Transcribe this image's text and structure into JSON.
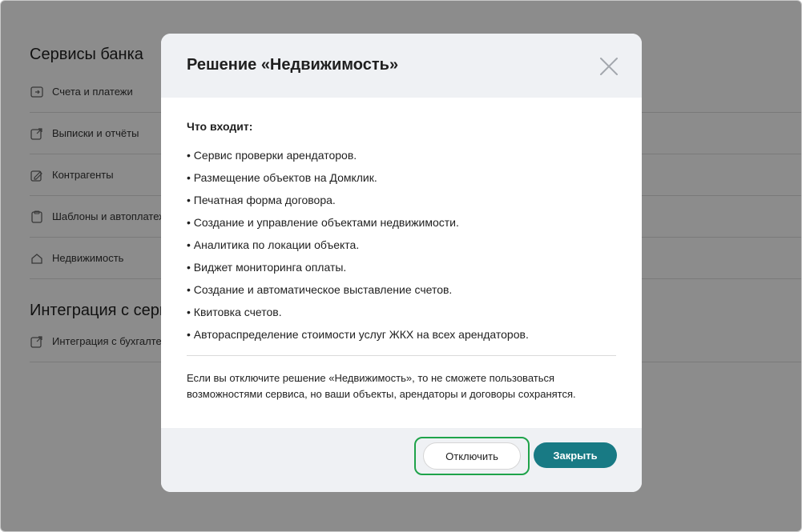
{
  "background": {
    "sections": [
      {
        "title": "Сервисы банка",
        "items": [
          {
            "label": "Счета и платежи"
          },
          {
            "label": "Выписки и отчёты"
          },
          {
            "label": "Контрагенты"
          },
          {
            "label": "Шаблоны и автоплатежи"
          },
          {
            "label": "Недвижимость"
          }
        ]
      },
      {
        "title": "Интеграция с сервисами",
        "items": [
          {
            "label": "Интеграция с бухгалтерией"
          }
        ]
      }
    ]
  },
  "modal": {
    "title": "Решение «Недвижимость»",
    "section_heading": "Что входит:",
    "features": [
      "• Сервис проверки арендаторов.",
      "• Размещение объектов на Домклик.",
      "• Печатная форма договора.",
      "• Создание и управление объектами недвижимости.",
      "• Аналитика по локации объекта.",
      "• Виджет мониторинга оплаты.",
      "• Создание и автоматическое выставление счетов.",
      "• Квитовка счетов.",
      "• Автораспределение стоимости услуг ЖКХ на всех арендаторов."
    ],
    "note": "Если вы отключите решение «Недвижимость», то не сможете пользоваться возможностями сервиса, но ваши объекты, арендаторы и договоры сохранятся.",
    "buttons": {
      "disable": "Отключить",
      "close": "Закрыть"
    }
  },
  "colors": {
    "primary": "#187a84",
    "highlight": "#1fa34a",
    "header_bg": "#eff1f4"
  }
}
